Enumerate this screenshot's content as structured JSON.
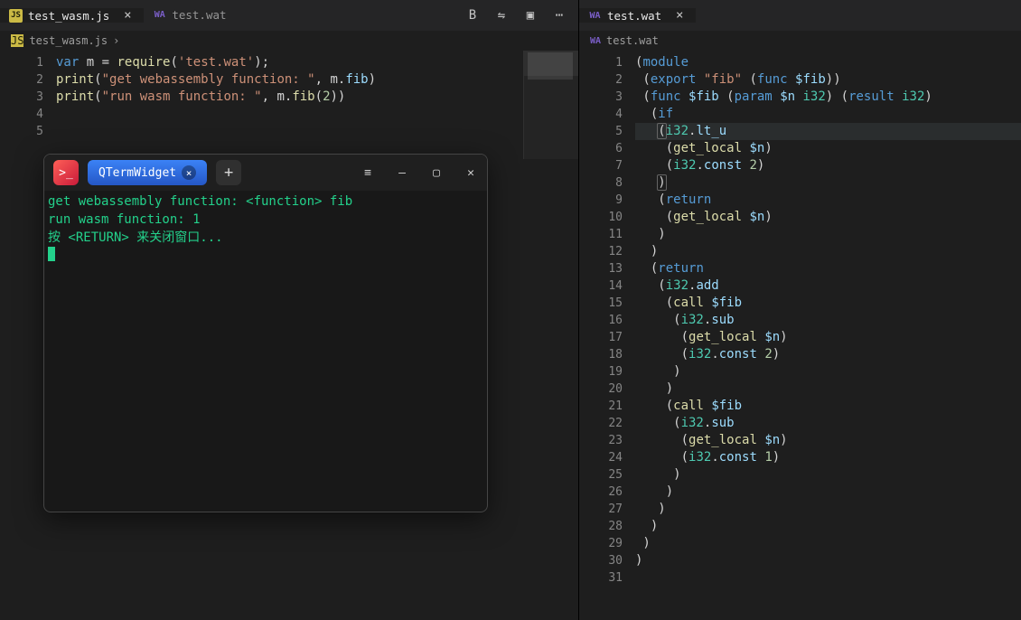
{
  "left": {
    "tabs": [
      {
        "icon": "JS",
        "icon_kind": "js",
        "label": "test_wasm.js",
        "closeable": true,
        "active": true
      },
      {
        "icon": "WA",
        "icon_kind": "wa",
        "label": "test.wat",
        "closeable": false,
        "active": false
      }
    ],
    "toolbar_icons": {
      "bold": "B",
      "diff": "⇋",
      "split": "▣",
      "more": "⋯"
    },
    "breadcrumb": {
      "icon": "JS",
      "file": "test_wasm.js",
      "sep": "›"
    },
    "line_count": 5,
    "code_tokens": [
      [
        [
          "kw",
          "var"
        ],
        [
          "pn",
          " m "
        ],
        [
          "pn",
          "= "
        ],
        [
          "fn",
          "r"
        ],
        [
          "fn",
          "equire"
        ],
        [
          "pn",
          "("
        ],
        [
          "str",
          "'test.wat'"
        ],
        [
          "pn",
          ");"
        ]
      ],
      [
        [
          "fn",
          "print"
        ],
        [
          "pn",
          "("
        ],
        [
          "str",
          "\"get webassembly function: \""
        ],
        [
          "pn",
          ", m."
        ],
        [
          "id",
          "fib"
        ],
        [
          "pn",
          ")"
        ]
      ],
      [
        [
          "fn",
          "print"
        ],
        [
          "pn",
          "("
        ],
        [
          "str",
          "\"run wasm function: \""
        ],
        [
          "pn",
          ", m."
        ],
        [
          "fn",
          "fib"
        ],
        [
          "pn",
          "("
        ],
        [
          "num",
          "2"
        ],
        [
          "pn",
          "))"
        ]
      ],
      [],
      []
    ]
  },
  "right": {
    "tabs": [
      {
        "icon": "WA",
        "icon_kind": "wa",
        "label": "test.wat",
        "closeable": true,
        "active": true
      }
    ],
    "breadcrumb": {
      "icon": "WA",
      "file": "test.wat"
    },
    "line_count": 31,
    "highlight_line": 5,
    "code_tokens": [
      [
        [
          "pn",
          "("
        ],
        [
          "kw",
          "module"
        ]
      ],
      [
        [
          "pn",
          " ("
        ],
        [
          "kw",
          "export"
        ],
        [
          "pn",
          " "
        ],
        [
          "str",
          "\"fib\""
        ],
        [
          "pn",
          " ("
        ],
        [
          "kw",
          "func"
        ],
        [
          "pn",
          " "
        ],
        [
          "id",
          "$fib"
        ],
        [
          "pn",
          "))"
        ]
      ],
      [
        [
          "pn",
          " ("
        ],
        [
          "kw",
          "func"
        ],
        [
          "pn",
          " "
        ],
        [
          "id",
          "$fib"
        ],
        [
          "pn",
          " ("
        ],
        [
          "kw",
          "param"
        ],
        [
          "pn",
          " "
        ],
        [
          "id",
          "$n"
        ],
        [
          "pn",
          " "
        ],
        [
          "ty",
          "i32"
        ],
        [
          "pn",
          ") ("
        ],
        [
          "kw",
          "result"
        ],
        [
          "pn",
          " "
        ],
        [
          "ty",
          "i32"
        ],
        [
          "pn",
          ")"
        ]
      ],
      [
        [
          "pn",
          "  ("
        ],
        [
          "kw",
          "if"
        ]
      ],
      [
        [
          "pn",
          "   "
        ],
        [
          "brhl",
          "("
        ],
        [
          "ty",
          "i32"
        ],
        [
          "pn",
          "."
        ],
        [
          "at",
          "lt_u"
        ]
      ],
      [
        [
          "pn",
          "    ("
        ],
        [
          "fn",
          "get_local"
        ],
        [
          "pn",
          " "
        ],
        [
          "id",
          "$n"
        ],
        [
          "pn",
          ")"
        ]
      ],
      [
        [
          "pn",
          "    ("
        ],
        [
          "ty",
          "i32"
        ],
        [
          "pn",
          "."
        ],
        [
          "at",
          "const"
        ],
        [
          "pn",
          " "
        ],
        [
          "num",
          "2"
        ],
        [
          "pn",
          ")"
        ]
      ],
      [
        [
          "pn",
          "   "
        ],
        [
          "brhl",
          ")"
        ]
      ],
      [
        [
          "pn",
          "   ("
        ],
        [
          "kw",
          "return"
        ]
      ],
      [
        [
          "pn",
          "    ("
        ],
        [
          "fn",
          "get_local"
        ],
        [
          "pn",
          " "
        ],
        [
          "id",
          "$n"
        ],
        [
          "pn",
          ")"
        ]
      ],
      [
        [
          "pn",
          "   )"
        ]
      ],
      [
        [
          "pn",
          "  )"
        ]
      ],
      [
        [
          "pn",
          "  ("
        ],
        [
          "kw",
          "return"
        ]
      ],
      [
        [
          "pn",
          "   ("
        ],
        [
          "ty",
          "i32"
        ],
        [
          "pn",
          "."
        ],
        [
          "at",
          "add"
        ]
      ],
      [
        [
          "pn",
          "    ("
        ],
        [
          "fn",
          "call"
        ],
        [
          "pn",
          " "
        ],
        [
          "id",
          "$fib"
        ]
      ],
      [
        [
          "pn",
          "     ("
        ],
        [
          "ty",
          "i32"
        ],
        [
          "pn",
          "."
        ],
        [
          "at",
          "sub"
        ]
      ],
      [
        [
          "pn",
          "      ("
        ],
        [
          "fn",
          "get_local"
        ],
        [
          "pn",
          " "
        ],
        [
          "id",
          "$n"
        ],
        [
          "pn",
          ")"
        ]
      ],
      [
        [
          "pn",
          "      ("
        ],
        [
          "ty",
          "i32"
        ],
        [
          "pn",
          "."
        ],
        [
          "at",
          "const"
        ],
        [
          "pn",
          " "
        ],
        [
          "num",
          "2"
        ],
        [
          "pn",
          ")"
        ]
      ],
      [
        [
          "pn",
          "     )"
        ]
      ],
      [
        [
          "pn",
          "    )"
        ]
      ],
      [
        [
          "pn",
          "    ("
        ],
        [
          "fn",
          "call"
        ],
        [
          "pn",
          " "
        ],
        [
          "id",
          "$fib"
        ]
      ],
      [
        [
          "pn",
          "     ("
        ],
        [
          "ty",
          "i32"
        ],
        [
          "pn",
          "."
        ],
        [
          "at",
          "sub"
        ]
      ],
      [
        [
          "pn",
          "      ("
        ],
        [
          "fn",
          "get_local"
        ],
        [
          "pn",
          " "
        ],
        [
          "id",
          "$n"
        ],
        [
          "pn",
          ")"
        ]
      ],
      [
        [
          "pn",
          "      ("
        ],
        [
          "ty",
          "i32"
        ],
        [
          "pn",
          "."
        ],
        [
          "at",
          "const"
        ],
        [
          "pn",
          " "
        ],
        [
          "num",
          "1"
        ],
        [
          "pn",
          ")"
        ]
      ],
      [
        [
          "pn",
          "     )"
        ]
      ],
      [
        [
          "pn",
          "    )"
        ]
      ],
      [
        [
          "pn",
          "   )"
        ]
      ],
      [
        [
          "pn",
          "  )"
        ]
      ],
      [
        [
          "pn",
          " )"
        ]
      ],
      [
        [
          "pn",
          ")"
        ]
      ],
      []
    ]
  },
  "terminal": {
    "app_icon_glyph": ">_",
    "tab_label": "QTermWidget",
    "plus": "+",
    "menu_icon": "≡",
    "min_icon": "—",
    "max_icon": "▢",
    "close_icon": "✕",
    "lines": [
      "get webassembly function:  <function> fib",
      "run wasm function:  1",
      "按 <RETURN> 来关闭窗口..."
    ]
  }
}
